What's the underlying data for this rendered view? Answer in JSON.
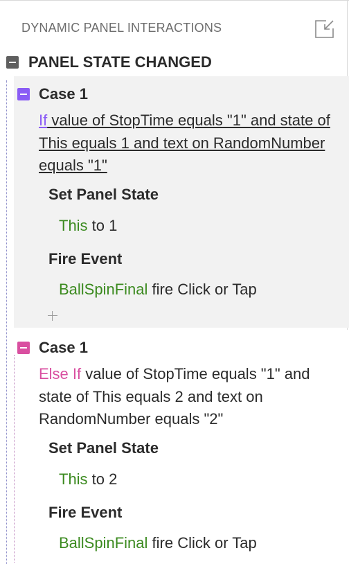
{
  "panel": {
    "title": "DYNAMIC PANEL INTERACTIONS",
    "expand_icon": "expand-to-popout-icon"
  },
  "event": {
    "label": "PANEL STATE CHANGED",
    "collapse_icon": "minus-square-icon"
  },
  "cases": [
    {
      "label": "Case 1",
      "keyword": "If",
      "condition": " value of StopTime equals \"1\" and state of This equals 1 and text on RandomNumber equals \"1\"",
      "actions": [
        {
          "title": "Set Panel State",
          "target": "This",
          "detail": " to 1"
        },
        {
          "title": "Fire Event",
          "target": "BallSpinFinal",
          "detail": " fire Click or Tap"
        }
      ],
      "add_icon": "plus-icon"
    },
    {
      "label": "Case 1",
      "keyword": "Else If",
      "condition": " value of StopTime equals \"1\" and state of This equals 2 and text on RandomNumber equals \"2\"",
      "actions": [
        {
          "title": "Set Panel State",
          "target": "This",
          "detail": " to 2"
        },
        {
          "title": "Fire Event",
          "target": "BallSpinFinal",
          "detail": " fire Click or Tap"
        }
      ]
    }
  ],
  "colors": {
    "if_keyword": "#8a5cf5",
    "else_if_keyword": "#d94fa0",
    "target_green": "#3b8a1f",
    "selected_case_bg": "#f2f2f2"
  }
}
